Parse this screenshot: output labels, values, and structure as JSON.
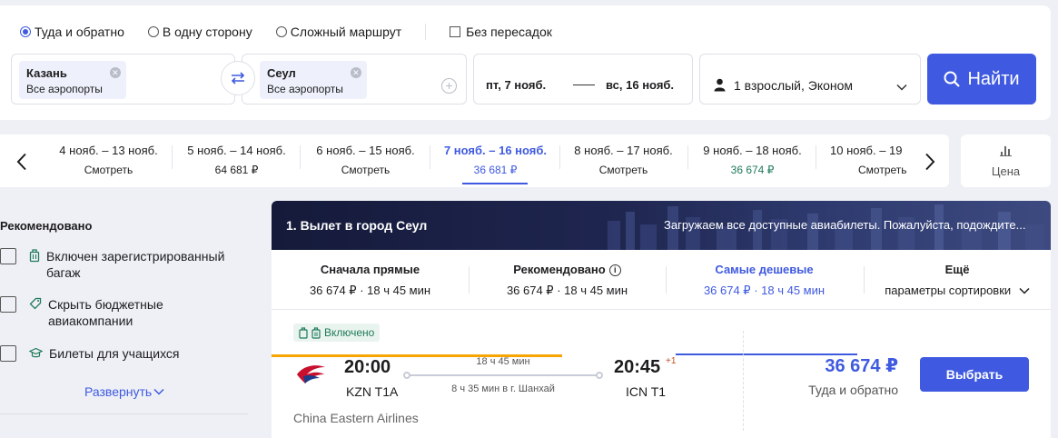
{
  "trip_types": [
    {
      "label": "Туда и обратно",
      "selected": true
    },
    {
      "label": "В одну сторону",
      "selected": false
    },
    {
      "label": "Сложный маршрут",
      "selected": false
    }
  ],
  "no_transfers_label": "Без пересадок",
  "from": {
    "city": "Казань",
    "airports": "Все аэропорты"
  },
  "to": {
    "city": "Сеул",
    "airports": "Все аэропорты"
  },
  "dates": {
    "depart": "пт, 7 нояб.",
    "return": "вс, 16 нояб."
  },
  "passengers": "1 взрослый, Эконом",
  "search_label": "Найти",
  "colors": {
    "accent": "#3f5ae0",
    "cheap": "#1f7a5a",
    "orange": "#f7a600"
  },
  "carousel": [
    {
      "dates": "4 нояб. – 13 нояб.",
      "price": "Смотреть"
    },
    {
      "dates": "5 нояб. – 14 нояб.",
      "price": "64 681 ₽"
    },
    {
      "dates": "6 нояб. – 15 нояб.",
      "price": "Смотреть"
    },
    {
      "dates": "7 нояб. – 16 нояб.",
      "price": "36 681 ₽"
    },
    {
      "dates": "8 нояб. – 17 нояб.",
      "price": "Смотреть"
    },
    {
      "dates": "9 нояб. – 18 нояб.",
      "price": "36 674 ₽"
    },
    {
      "dates": "10 нояб. – 19",
      "price": "Смотреть"
    }
  ],
  "price_graph_label": "Цена",
  "filters": {
    "title": "Рекомендовано",
    "items": [
      {
        "label": "Включен зарегистрированный багаж",
        "icon": "luggage-icon"
      },
      {
        "label": "Скрыть бюджетные авиакомпании",
        "icon": "tag-icon"
      },
      {
        "label": "Билеты для учащихся",
        "icon": "graduation-cap-icon"
      }
    ],
    "expand_label": "Развернуть"
  },
  "results": {
    "title": "1. Вылет в город Сеул",
    "status": "Загружаем все доступные авиабилеты. Пожалуйста, подождите..."
  },
  "sort_tabs": [
    {
      "title": "Сначала прямые",
      "value": "36 674 ₽ · 18 ч 45 мин"
    },
    {
      "title": "Рекомендовано",
      "value": "36 674 ₽ · 18 ч 45 мин"
    },
    {
      "title": "Самые дешевые",
      "value": "36 674 ₽ · 18 ч 45 мин"
    },
    {
      "title": "Ещё",
      "value": "параметры сортировки"
    }
  ],
  "ticket": {
    "badge": "Включено",
    "dep_time": "20:00",
    "dep_code": "KZN T1A",
    "duration": "18 ч 45 мин",
    "layover": "8 ч 35 мин в г. Шанхай",
    "arr_time": "20:45",
    "arr_plus": "+1",
    "arr_code": "ICN T1",
    "airline": "China Eastern Airlines",
    "price": "36 674 ₽",
    "price_note": "Туда и обратно",
    "select_label": "Выбрать"
  }
}
